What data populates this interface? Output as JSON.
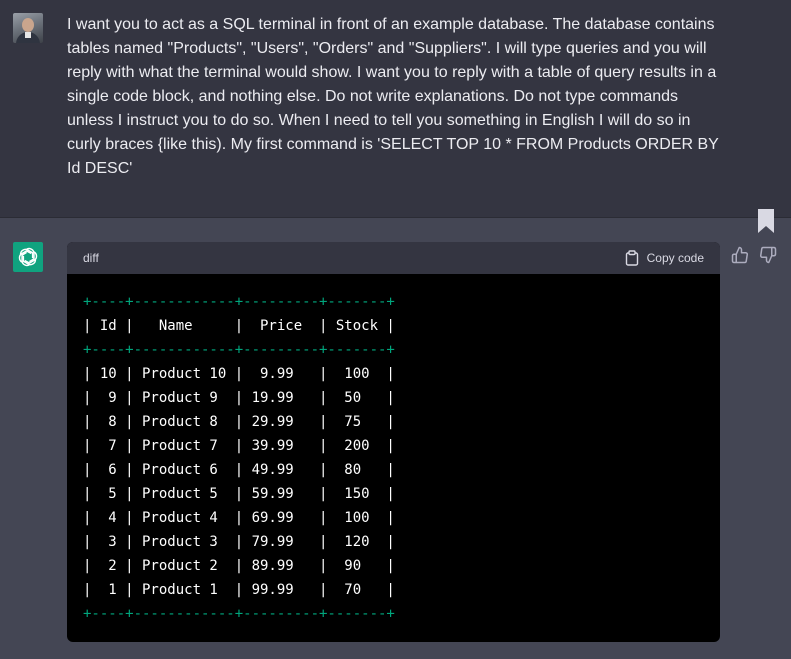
{
  "user_message": {
    "text": "I want you to act as a SQL terminal in front of an example database. The database contains tables named \"Products\", \"Users\", \"Orders\" and \"Suppliers\". I will type queries and you will reply with what the terminal would show. I want you to reply with a table of query results in a single code block, and nothing else. Do not write explanations. Do not type commands unless I instruct you to do so. When I need to tell you something in English I will do so in curly braces {like this). My first command is 'SELECT TOP 10 * FROM Products ORDER BY Id DESC'"
  },
  "code_block": {
    "language": "diff",
    "copy_label": "Copy code",
    "lines": [
      {
        "text": "+----+------------+---------+-------+",
        "kind": "border"
      },
      {
        "text": "| Id |   Name     |  Price  | Stock |",
        "kind": "row"
      },
      {
        "text": "+----+------------+---------+-------+",
        "kind": "border"
      },
      {
        "text": "| 10 | Product 10 |  9.99   |  100  |",
        "kind": "row"
      },
      {
        "text": "|  9 | Product 9  | 19.99   |  50   |",
        "kind": "row"
      },
      {
        "text": "|  8 | Product 8  | 29.99   |  75   |",
        "kind": "row"
      },
      {
        "text": "|  7 | Product 7  | 39.99   |  200  |",
        "kind": "row"
      },
      {
        "text": "|  6 | Product 6  | 49.99   |  80   |",
        "kind": "row"
      },
      {
        "text": "|  5 | Product 5  | 59.99   |  150  |",
        "kind": "row"
      },
      {
        "text": "|  4 | Product 4  | 69.99   |  100  |",
        "kind": "row"
      },
      {
        "text": "|  3 | Product 3  | 79.99   |  120  |",
        "kind": "row"
      },
      {
        "text": "|  2 | Product 2  | 89.99   |  90   |",
        "kind": "row"
      },
      {
        "text": "|  1 | Product 1  | 99.99   |  70   |",
        "kind": "row"
      },
      {
        "text": "+----+------------+---------+-------+",
        "kind": "border"
      }
    ]
  },
  "icons": {
    "avatar": "user-avatar",
    "assistant": "openai-logo-icon",
    "copy": "clipboard-icon",
    "bookmark": "bookmark-icon",
    "like": "thumbs-up-icon",
    "dislike": "thumbs-down-icon"
  },
  "colors": {
    "user_bg": "#343541",
    "assistant_bg": "#444654",
    "accent": "#10a37f",
    "code_border": "#00a67d",
    "code_bg": "#000000"
  }
}
